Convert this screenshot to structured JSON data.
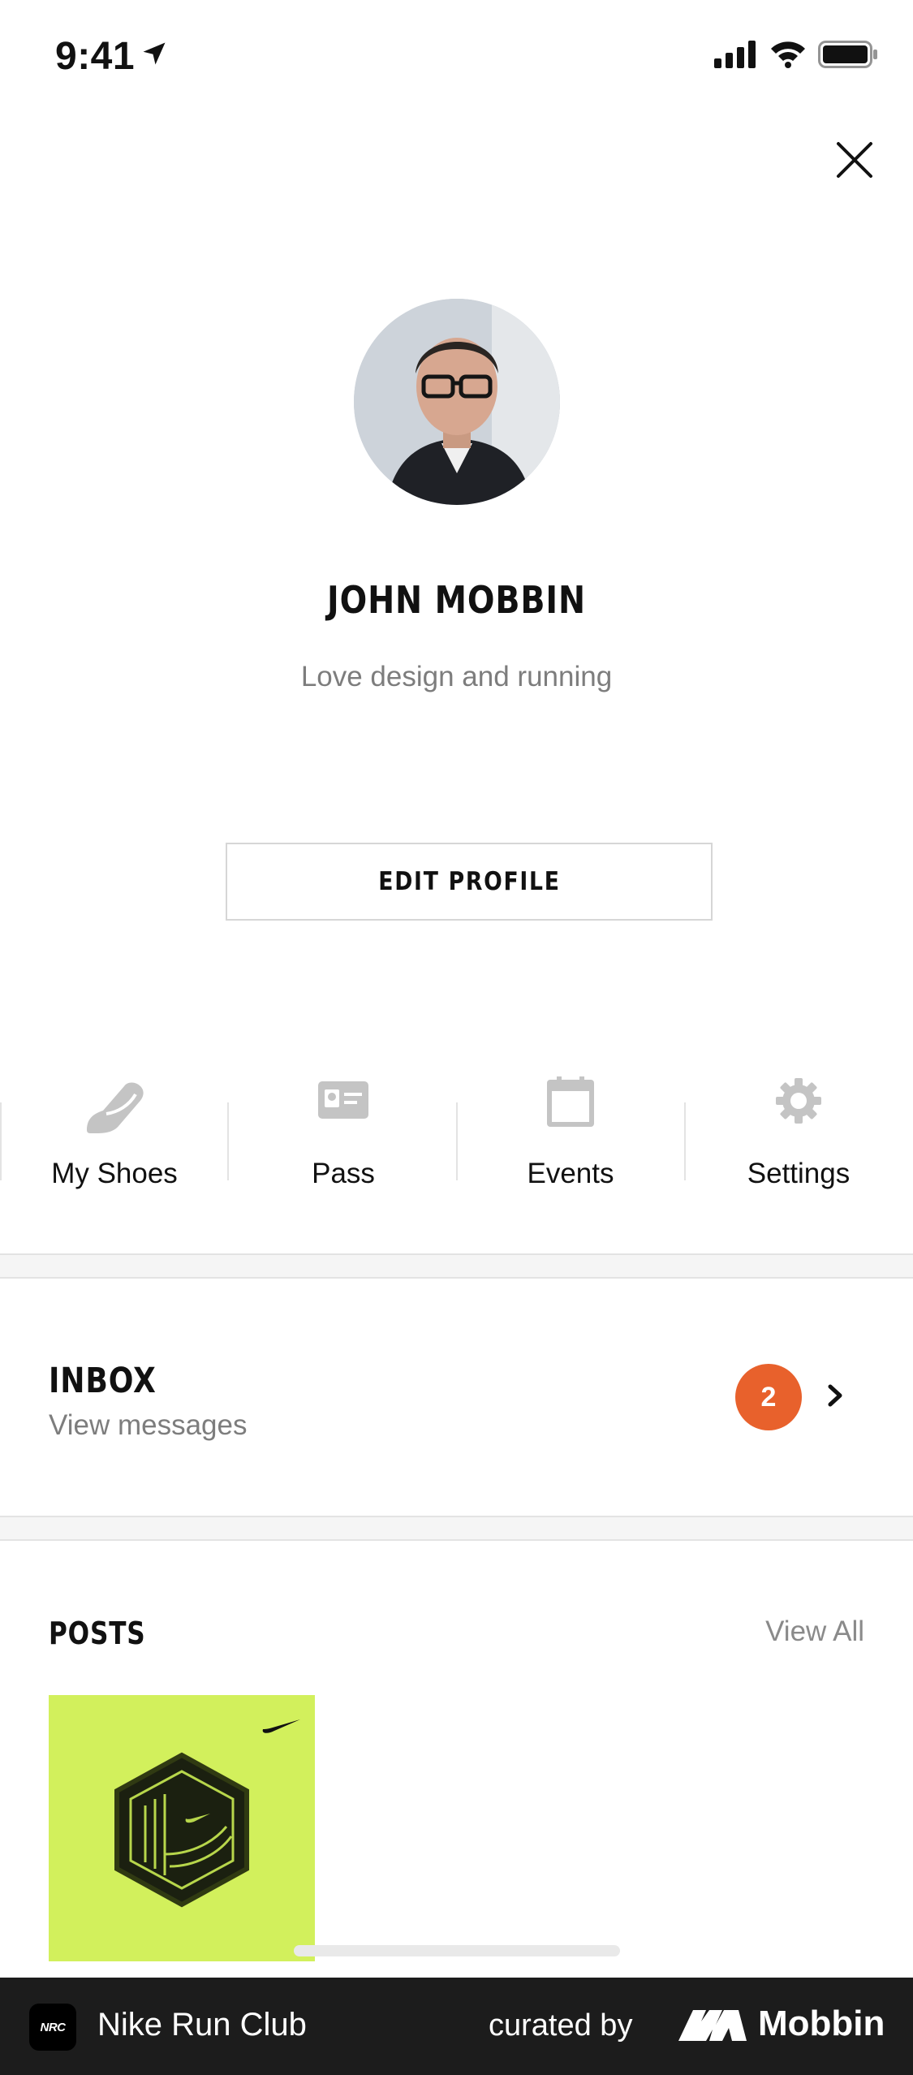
{
  "status_bar": {
    "time": "9:41"
  },
  "profile": {
    "name": "JOHN MOBBIN",
    "bio": "Love design and running",
    "edit_label": "EDIT PROFILE"
  },
  "shortcuts": [
    {
      "label": "My Shoes",
      "icon": "shoe-icon"
    },
    {
      "label": "Pass",
      "icon": "id-card-icon"
    },
    {
      "label": "Events",
      "icon": "calendar-icon"
    },
    {
      "label": "Settings",
      "icon": "gear-icon"
    }
  ],
  "inbox": {
    "title": "INBOX",
    "subtitle": "View messages",
    "badge_count": "2"
  },
  "posts": {
    "title": "POSTS",
    "view_all": "View All"
  },
  "footer": {
    "app_name": "Nike Run Club",
    "app_icon_text": "NRC",
    "curated_by": "curated by",
    "brand": "Mobbin"
  },
  "colors": {
    "badge": "#e8612c",
    "post_tile": "#d2f05c",
    "footer_bg": "#1c1c1c",
    "icon_gray": "#c4c4c4"
  }
}
